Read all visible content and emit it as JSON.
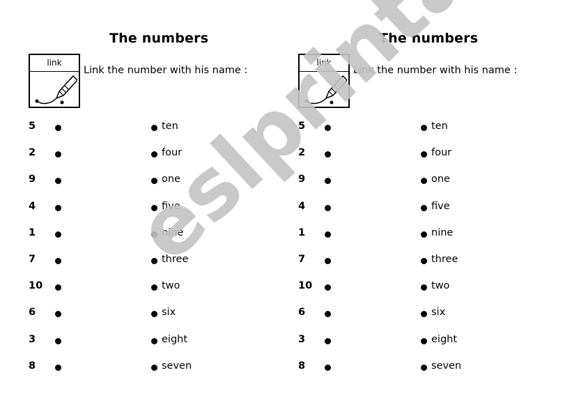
{
  "worksheet": {
    "title": "The numbers",
    "icon_label": "link",
    "instruction": "Link the number with his name :",
    "numbers": [
      "5",
      "2",
      "9",
      "4",
      "1",
      "7",
      "10",
      "6",
      "3",
      "8"
    ],
    "words": [
      "ten",
      "four",
      "one",
      "five",
      "nine",
      "three",
      "two",
      "six",
      "eight",
      "seven"
    ]
  },
  "watermark": {
    "text": "eslprintables.com",
    "color": "#c4c4c4"
  }
}
